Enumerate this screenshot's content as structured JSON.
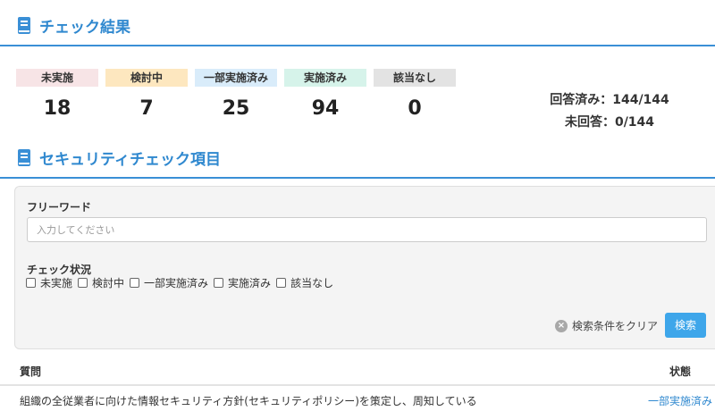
{
  "results_section": {
    "title": "チェック結果",
    "icon": "book-icon"
  },
  "status_cards": [
    {
      "label": "未実施",
      "count": "18",
      "color": "#f7e4e6"
    },
    {
      "label": "検討中",
      "count": "7",
      "color": "#fde7bf"
    },
    {
      "label": "一部実施済み",
      "count": "25",
      "color": "#d9ecfa"
    },
    {
      "label": "実施済み",
      "count": "94",
      "color": "#d6f3ea"
    },
    {
      "label": "該当なし",
      "count": "0",
      "color": "#e3e3e3"
    }
  ],
  "summary": {
    "answered": "回答済み：144/144",
    "unanswered": "未回答：0/144"
  },
  "items_section": {
    "title": "セキュリティチェック項目",
    "icon": "book-icon"
  },
  "search": {
    "freeword_label": "フリーワード",
    "freeword_placeholder": "入力してください",
    "freeword_value": "",
    "status_label": "チェック状況",
    "status_options": [
      "未実施",
      "検討中",
      "一部実施済み",
      "実施済み",
      "該当なし"
    ],
    "clear_label": "検索条件をクリア",
    "clear_icon": "clear-x-icon",
    "search_label": "検索",
    "accent_color": "#3ea6ea"
  },
  "table": {
    "col_question": "質問",
    "col_status": "状態",
    "rows": [
      {
        "question": "組織の全従業者に向けた情報セキュリティ方針(セキュリティポリシー)を策定し、周知している",
        "status": "一部実施済み"
      }
    ]
  }
}
